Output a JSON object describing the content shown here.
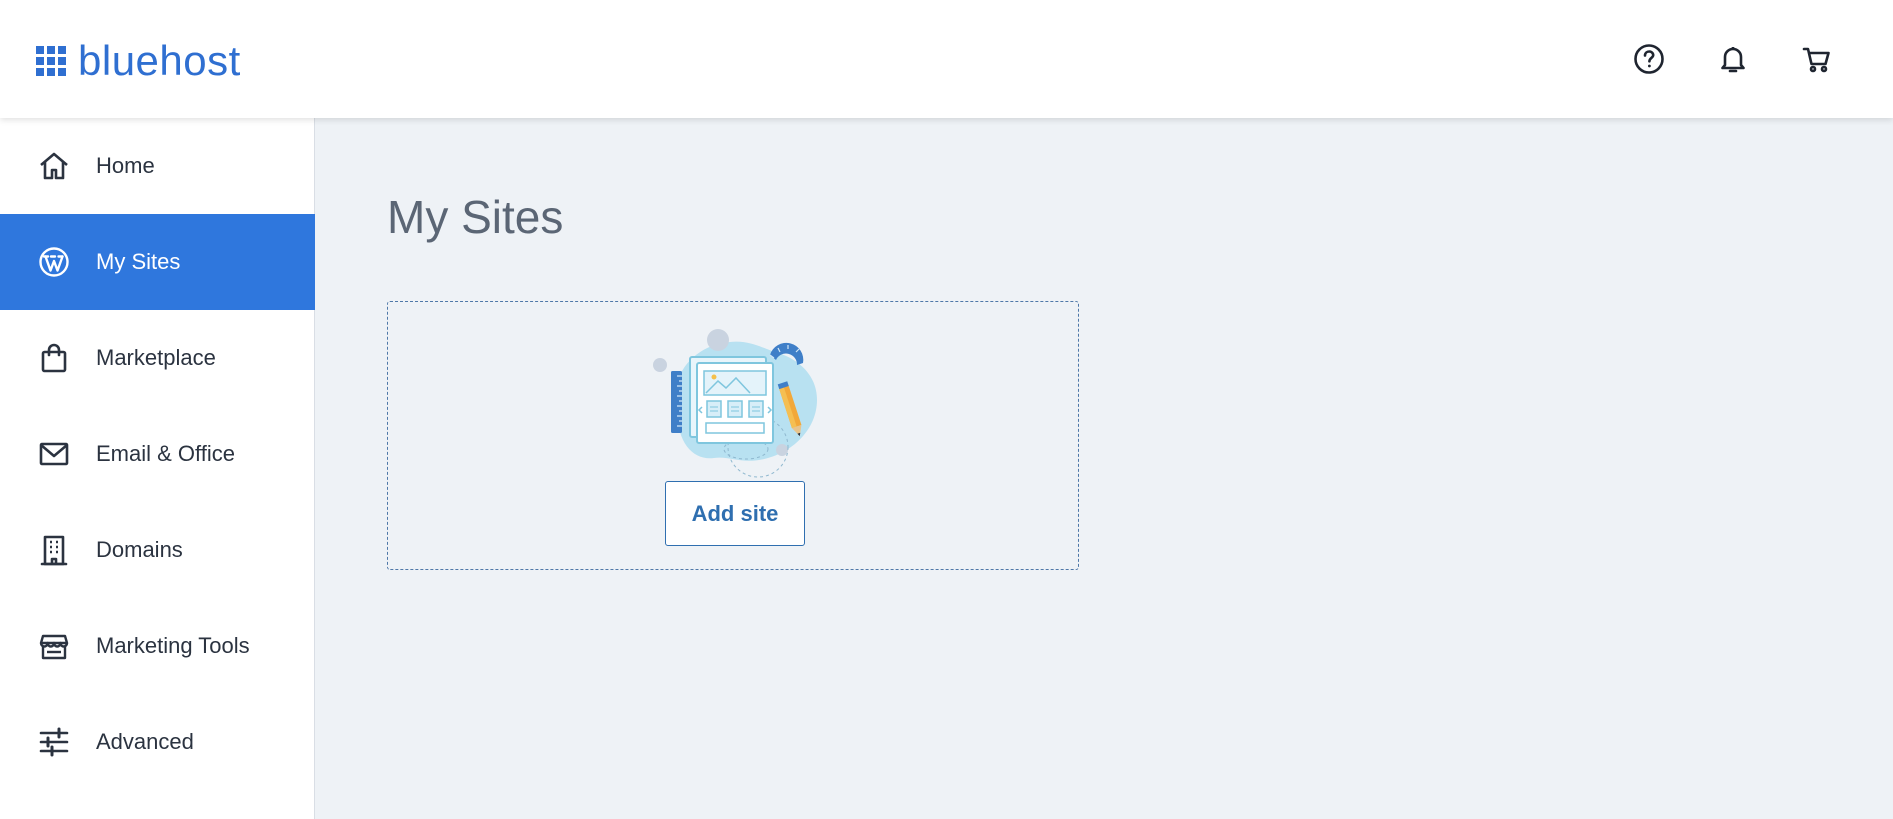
{
  "brand": {
    "name": "bluehost",
    "color": "#2f6fd1"
  },
  "header": {
    "icons": [
      "help-circle-icon",
      "bell-icon",
      "cart-icon"
    ]
  },
  "sidebar": {
    "active_color": "#2f77dd",
    "items": [
      {
        "label": "Home",
        "icon": "home-icon",
        "active": false
      },
      {
        "label": "My Sites",
        "icon": "wordpress-icon",
        "active": true
      },
      {
        "label": "Marketplace",
        "icon": "shopping-bag-icon",
        "active": false
      },
      {
        "label": "Email & Office",
        "icon": "envelope-icon",
        "active": false
      },
      {
        "label": "Domains",
        "icon": "building-icon",
        "active": false
      },
      {
        "label": "Marketing Tools",
        "icon": "storefront-icon",
        "active": false
      },
      {
        "label": "Advanced",
        "icon": "sliders-icon",
        "active": false
      }
    ]
  },
  "main": {
    "title": "My Sites",
    "card": {
      "illustration": "website-builder-illustration",
      "add_button_label": "Add site"
    }
  }
}
